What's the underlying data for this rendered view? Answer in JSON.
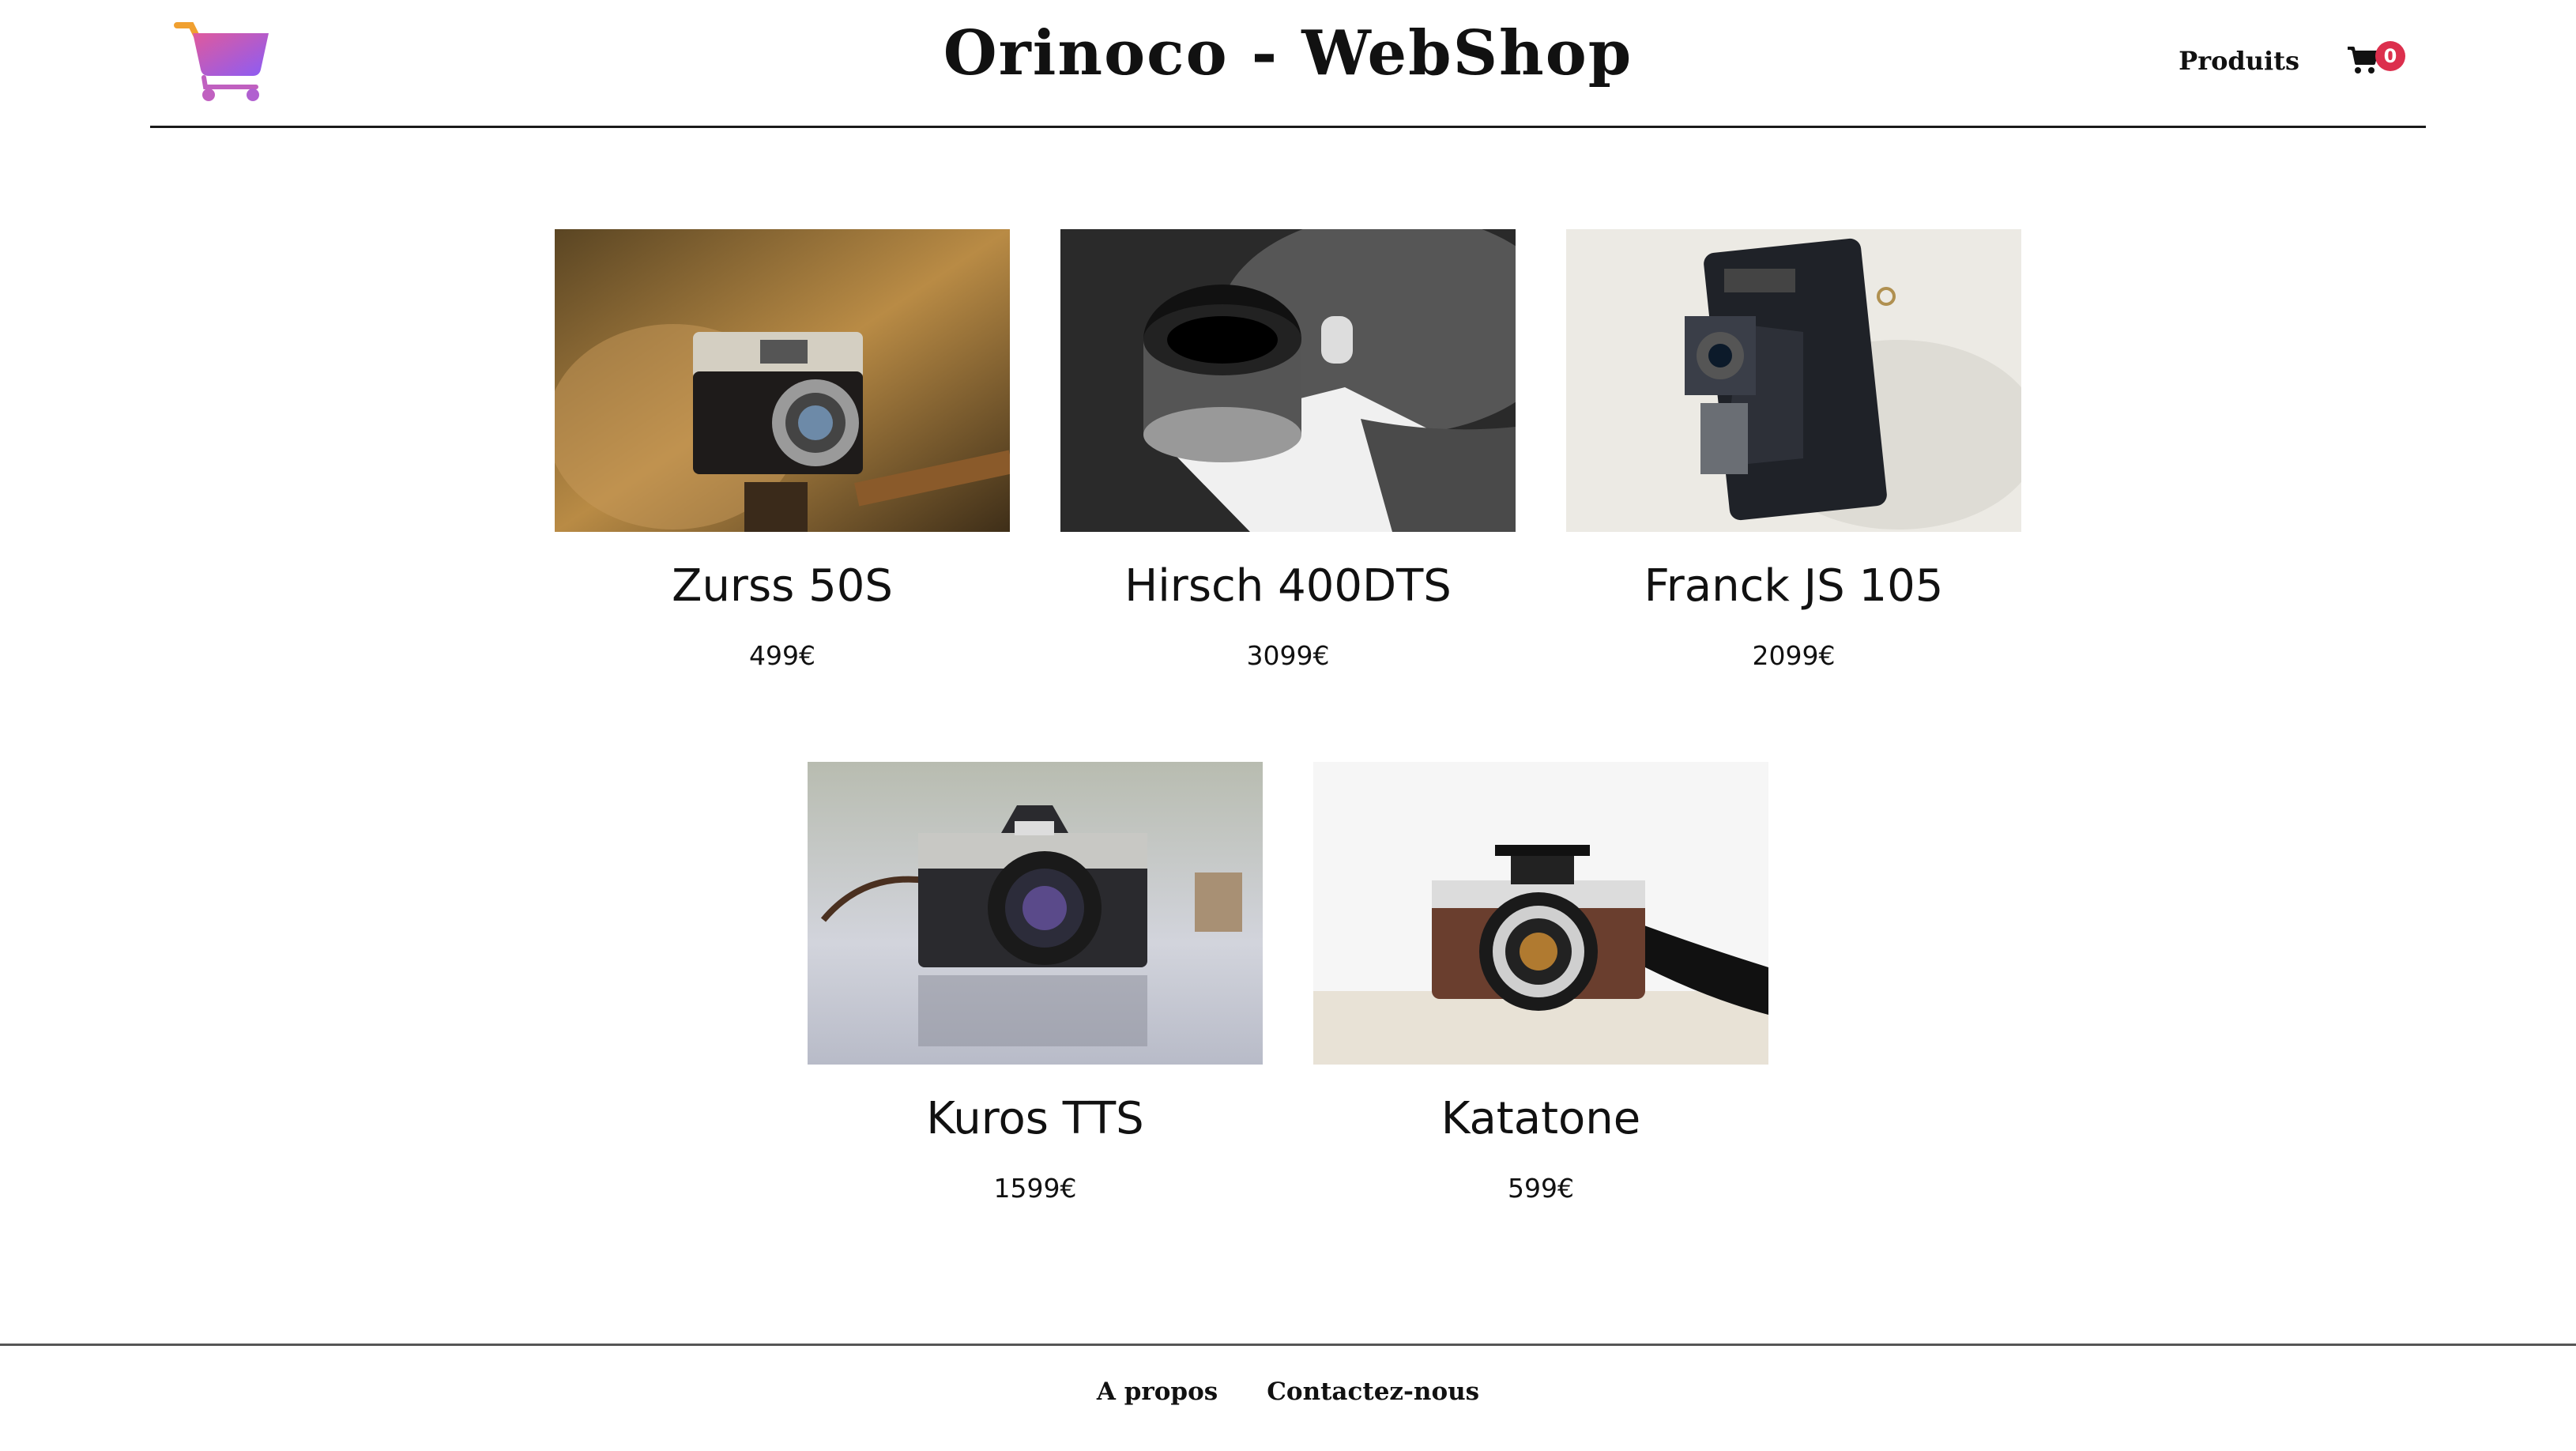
{
  "header": {
    "logo_icon": "shopping-cart-icon",
    "title": "Orinoco - WebShop",
    "nav": {
      "products_label": "Produits",
      "cart_icon": "cart-icon",
      "cart_count": "0"
    }
  },
  "colors": {
    "cart_badge": "#dc2f4d",
    "logo_gradient_start": "#e05a9c",
    "logo_gradient_end": "#8a5cf6",
    "logo_handle": "#f0a030"
  },
  "products": [
    {
      "name": "Zurss 50S",
      "price": "499€"
    },
    {
      "name": "Hirsch 400DTS",
      "price": "3099€"
    },
    {
      "name": "Franck JS 105",
      "price": "2099€"
    },
    {
      "name": "Kuros TTS",
      "price": "1599€"
    },
    {
      "name": "Katatone",
      "price": "599€"
    }
  ],
  "footer": {
    "about_label": "A propos",
    "contact_label": "Contactez-nous"
  }
}
